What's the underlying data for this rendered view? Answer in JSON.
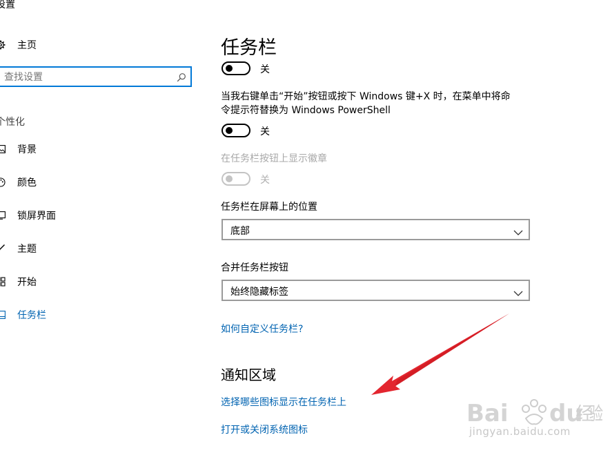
{
  "window": {
    "title": "设置"
  },
  "sidebar": {
    "home_label": "主页",
    "search_placeholder": "查找设置",
    "group_header": "个性化",
    "items": [
      {
        "label": "背景",
        "icon": "picture-icon"
      },
      {
        "label": "颜色",
        "icon": "palette-icon"
      },
      {
        "label": "锁屏界面",
        "icon": "lock-screen-icon"
      },
      {
        "label": "主题",
        "icon": "brush-icon"
      },
      {
        "label": "开始",
        "icon": "start-menu-icon"
      },
      {
        "label": "任务栏",
        "icon": "taskbar-icon",
        "active": true
      }
    ]
  },
  "main": {
    "title": "任务栏",
    "toggle1": {
      "state_label": "关"
    },
    "powershell_desc_line1": "当我右键单击“开始”按钮或按下 Windows 键+X 时，在菜单中将命",
    "powershell_desc_line2": "令提示符替换为 Windows PowerShell",
    "toggle2": {
      "state_label": "关"
    },
    "badges_desc": "在任务栏按钮上显示徽章",
    "toggle3": {
      "state_label": "关"
    },
    "position_label": "任务栏在屏幕上的位置",
    "position_value": "底部",
    "combine_label": "合并任务栏按钮",
    "combine_value": "始终隐藏标签",
    "customize_link": "如何自定义任务栏?",
    "notify_section_title": "通知区域",
    "select_icons_link": "选择哪些图标显示在任务栏上",
    "system_icons_link": "打开或关闭系统图标"
  },
  "colors": {
    "accent": "#0078d7",
    "link": "#0063b1",
    "arrow": "#e3262f"
  },
  "watermark": {
    "logo": "Baidu经验",
    "url": "jingyan.baidu.com"
  }
}
